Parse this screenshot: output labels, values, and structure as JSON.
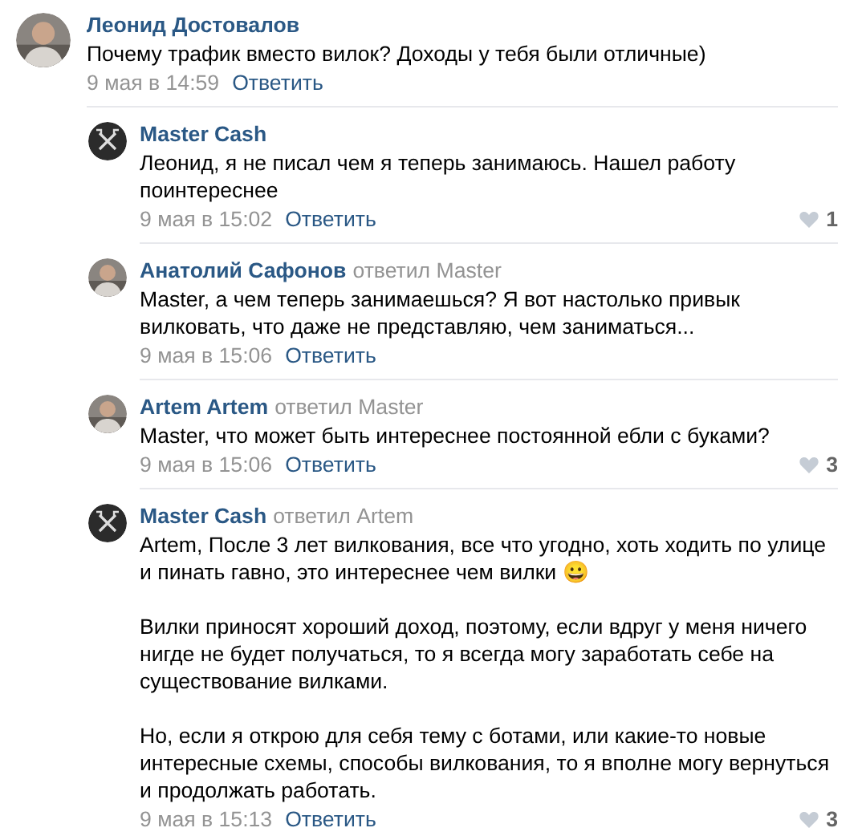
{
  "comments": [
    {
      "author": "Леонид Достовалов",
      "paragraphs": [
        "Почему трафик вместо вилок? Доходы у тебя были отличные)"
      ],
      "date": "9 мая в 14:59",
      "reply_action": "Ответить",
      "replies": [
        {
          "author": "Master Cash",
          "avatar": {
            "kind": "logo"
          },
          "paragraphs": [
            "Леонид, я не писал чем я теперь занимаюсь. Нашел работу поинтереснее"
          ],
          "date": "9 мая в 15:02",
          "reply_action": "Ответить",
          "likes": "1"
        },
        {
          "author": "Анатолий Сафонов",
          "reply_to": "ответил Master",
          "paragraphs": [
            "Master, а чем теперь занимаешься? Я вот настолько привык вилковать, что даже не представляю, чем заниматься..."
          ],
          "date": "9 мая в 15:06",
          "reply_action": "Ответить"
        },
        {
          "author": "Artem Artem",
          "reply_to": "ответил Master",
          "paragraphs": [
            "Master, что может быть интереснее постоянной ебли с буками?"
          ],
          "date": "9 мая в 15:06",
          "reply_action": "Ответить",
          "likes": "3"
        },
        {
          "author": "Master Cash",
          "reply_to": "ответил Artem",
          "avatar": {
            "kind": "logo"
          },
          "paragraphs": [
            "Artem, После 3 лет вилкования, все что угодно, хоть ходить по улице и пинать гавно, это интереснее чем вилки 😀",
            "Вилки приносят хороший доход, поэтому, если вдруг у меня ничего нигде не будет получаться, то я всегда могу заработать себе на существование вилками.",
            "Но, если я открою для себя тему с ботами, или какие-то новые интересные схемы, способы вилкования, то я вполне могу вернуться и продолжать работать."
          ],
          "date": "9 мая в 15:13",
          "reply_action": "Ответить",
          "likes": "3"
        }
      ]
    }
  ]
}
